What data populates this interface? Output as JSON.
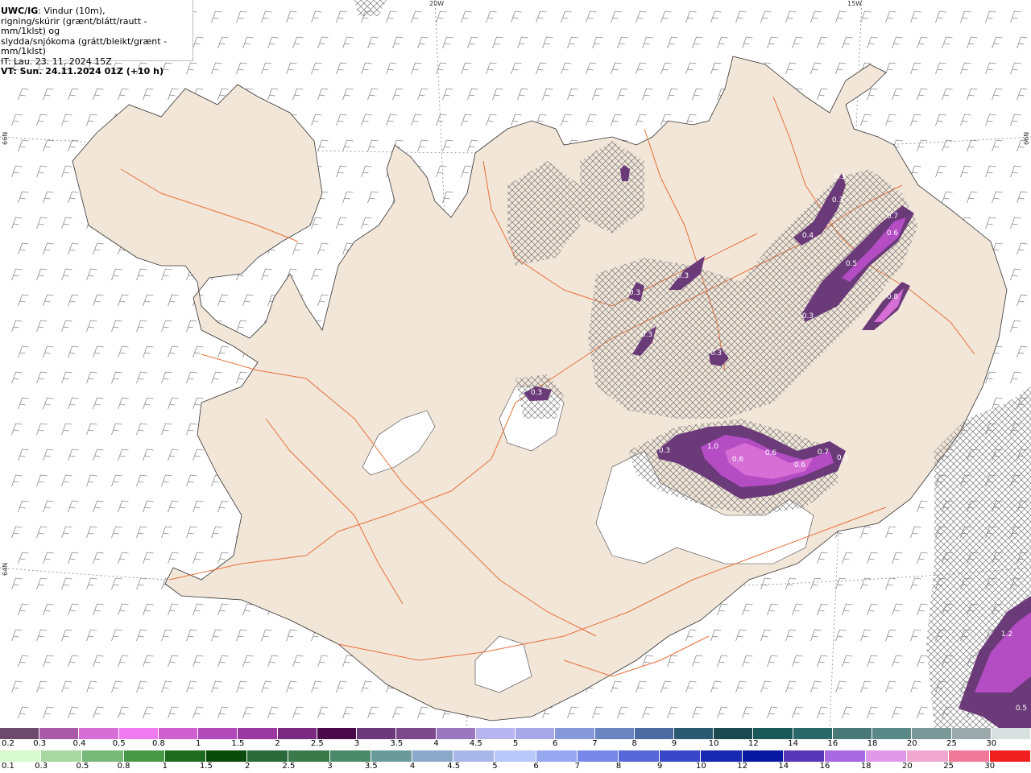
{
  "header": {
    "model": "UWC/IG",
    "line1_rest": ": Vindur (10m),",
    "line2": "rigning/skúrir (grænt/blátt/rautt - mm/1klst) og",
    "line3": "slydda/snjókoma (grátt/bleikt/grænt - mm/1klst)",
    "it_line": "IT: Lau. 23. 11. 2024 15Z",
    "vt_line": "VT: Sun. 24.11.2024 01Z (+10 h)"
  },
  "graticule": {
    "lon_20w": "20W",
    "lon_15w": "15W",
    "lat_66n_left": "66N",
    "lat_66n_right": "66N",
    "lat_64n_left": "64N"
  },
  "colors": {
    "land": "#f2e6d9",
    "roads": "#e8703a",
    "hatch": "#777777",
    "precip_dark": "#6b3a78",
    "precip_mid": "#b44cc4",
    "precip_light": "#e87ce8"
  },
  "precip_labels": [
    {
      "value": "0.3"
    },
    {
      "value": "0.3"
    },
    {
      "value": "0.4"
    },
    {
      "value": "0.7"
    },
    {
      "value": "0.6"
    },
    {
      "value": "0.5"
    },
    {
      "value": "0.3"
    },
    {
      "value": "0.3"
    },
    {
      "value": "0.3"
    },
    {
      "value": "0.3"
    },
    {
      "value": "0.8"
    },
    {
      "value": "0.3"
    },
    {
      "value": "0.3"
    },
    {
      "value": "0.3"
    },
    {
      "value": "1.0"
    },
    {
      "value": "0.6"
    },
    {
      "value": "0.6"
    },
    {
      "value": "0.6"
    },
    {
      "value": "0.7"
    },
    {
      "value": "0.3"
    },
    {
      "value": "1.2"
    },
    {
      "value": "0.5"
    }
  ],
  "snow_scale": {
    "labels": [
      "0.2",
      "0.3",
      "0.4",
      "0.5",
      "0.8",
      "1",
      "1.5",
      "2",
      "2.5",
      "3",
      "3.5",
      "4",
      "4.5",
      "5",
      "6",
      "7",
      "8",
      "9",
      "10",
      "12",
      "14",
      "16",
      "18",
      "20",
      "25",
      "30"
    ],
    "colors": [
      "#6b4a6b",
      "#a85aa8",
      "#d66ed6",
      "#f07af0",
      "#d060d0",
      "#b048b8",
      "#9a3aa0",
      "#7a2a80",
      "#4a0a4a",
      "#6a3a7a",
      "#7a4a8a",
      "#9a78c0",
      "#b8b4f0",
      "#a8a8e8",
      "#8898d8",
      "#6a84c0",
      "#4a6aa0",
      "#2a5a70",
      "#1a4a50",
      "#1a5858",
      "#2a6868",
      "#4a7878",
      "#5a8888",
      "#7a9898",
      "#9aaaaa",
      "#d8e0e0"
    ]
  },
  "rain_scale": {
    "labels": [
      "0.1",
      "0.3",
      "0.5",
      "0.8",
      "1",
      "1.5",
      "2",
      "2.5",
      "3",
      "3.5",
      "4",
      "4.5",
      "5",
      "6",
      "7",
      "8",
      "9",
      "10",
      "12",
      "14",
      "16",
      "18",
      "20",
      "25",
      "30"
    ],
    "colors": [
      "#d8f8d0",
      "#a8d8a0",
      "#78b878",
      "#489848",
      "#1e6a1e",
      "#0a4a0a",
      "#2a6a3a",
      "#3a7a4a",
      "#4a8a6a",
      "#6a9a9a",
      "#8aa8c8",
      "#a8b8e8",
      "#b8c8f8",
      "#98a8f0",
      "#7888e8",
      "#5868d8",
      "#3848c8",
      "#1828b0",
      "#0818a0",
      "#5838b8",
      "#a868e0",
      "#e098e8",
      "#f0a8d0",
      "#f07898",
      "#f02020"
    ]
  }
}
